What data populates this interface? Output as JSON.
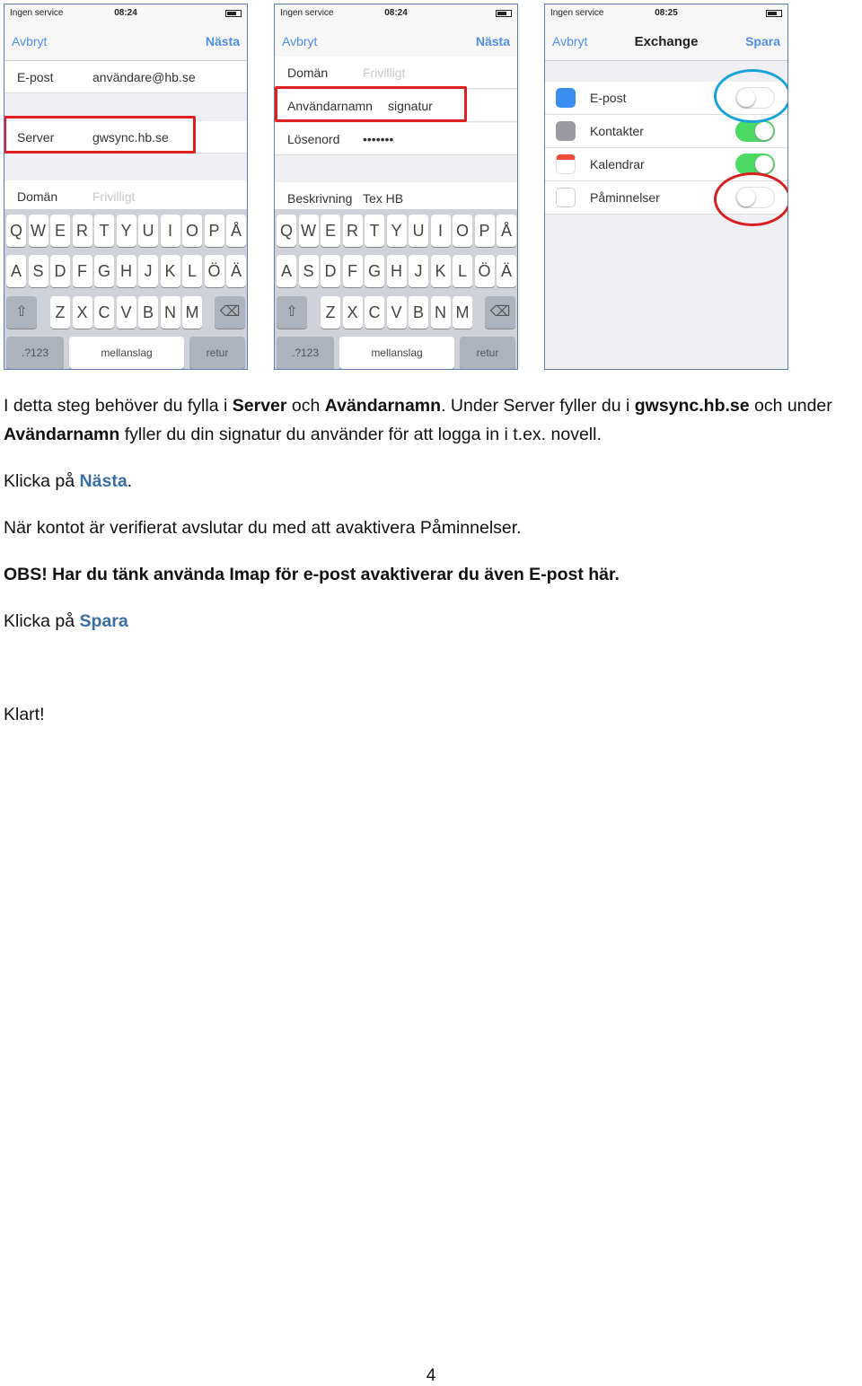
{
  "phone1": {
    "status": {
      "carrier": "Ingen service",
      "time": "08:24"
    },
    "nav": {
      "left": "Avbryt",
      "right": "Nästa"
    },
    "rows": [
      {
        "label": "E-post",
        "value": "användare@hb.se"
      },
      {
        "label": "Server",
        "value": "gwsync.hb.se"
      },
      {
        "label": "Domän",
        "placeholder": "Frivilligt"
      }
    ],
    "keys": {
      "row1": [
        "Q",
        "W",
        "E",
        "R",
        "T",
        "Y",
        "U",
        "I",
        "O",
        "P",
        "Å"
      ],
      "row2": [
        "A",
        "S",
        "D",
        "F",
        "G",
        "H",
        "J",
        "K",
        "L",
        "Ö",
        "Ä"
      ],
      "row3": [
        "Z",
        "X",
        "C",
        "V",
        "B",
        "N",
        "M"
      ],
      "num": ".?123",
      "space": "mellanslag",
      "ret": "retur"
    }
  },
  "phone2": {
    "status": {
      "carrier": "Ingen service",
      "time": "08:24"
    },
    "nav": {
      "left": "Avbryt",
      "right": "Nästa"
    },
    "rows": [
      {
        "label": "Domän",
        "placeholder": "Frivilligt"
      },
      {
        "label": "Användarnamn",
        "value": "signatur"
      },
      {
        "label": "Lösenord",
        "value": "•••••••"
      },
      {
        "label": "Beskrivning",
        "value": "Tex HB"
      }
    ],
    "keys": {
      "row1": [
        "Q",
        "W",
        "E",
        "R",
        "T",
        "Y",
        "U",
        "I",
        "O",
        "P",
        "Å"
      ],
      "row2": [
        "A",
        "S",
        "D",
        "F",
        "G",
        "H",
        "J",
        "K",
        "L",
        "Ö",
        "Ä"
      ],
      "row3": [
        "Z",
        "X",
        "C",
        "V",
        "B",
        "N",
        "M"
      ],
      "num": ".?123",
      "space": "mellanslag",
      "ret": "retur"
    }
  },
  "phone3": {
    "status": {
      "carrier": "Ingen service",
      "time": "08:25"
    },
    "nav": {
      "left": "Avbryt",
      "title": "Exchange",
      "right": "Spara"
    },
    "toggles": [
      {
        "label": "E-post",
        "on": false,
        "icon": "mail-icon",
        "color": "#3b8ef0"
      },
      {
        "label": "Kontakter",
        "on": true,
        "icon": "contacts-icon",
        "color": "#9a9aa0"
      },
      {
        "label": "Kalendrar",
        "on": true,
        "icon": "calendar-icon",
        "color": "#f04a3a"
      },
      {
        "label": "Påminnelser",
        "on": false,
        "icon": "reminders-icon",
        "color": "#8e8e93"
      }
    ]
  },
  "text": {
    "p1": {
      "a": "I detta steg behöver du fylla i ",
      "b": "Server",
      "c": " och ",
      "d": "Avändarnamn",
      "e": ". Under Server fyller du i ",
      "f": "gwsync.hb.se",
      "g": " och under",
      "h": "Avändarnamn",
      "i": " fyller du din signatur du använder för att logga in i t.ex. novell."
    },
    "p2": {
      "a": "Klicka på ",
      "b": "Nästa",
      "c": "."
    },
    "p3": "När kontot är verifierat avslutar du med att avaktivera Påminnelser.",
    "p4": "OBS! Har du tänk använda Imap för e-post avaktiverar du även E-post här.",
    "p5": {
      "a": "Klicka på ",
      "b": "Spara"
    },
    "p6": "Klart!"
  },
  "page_number": "4",
  "colors": {
    "highlight_red": "#e02020",
    "highlight_blue": "#1aa3d9",
    "ios_blue": "#4f8ee8",
    "link_blue": "#3a6ea5"
  }
}
